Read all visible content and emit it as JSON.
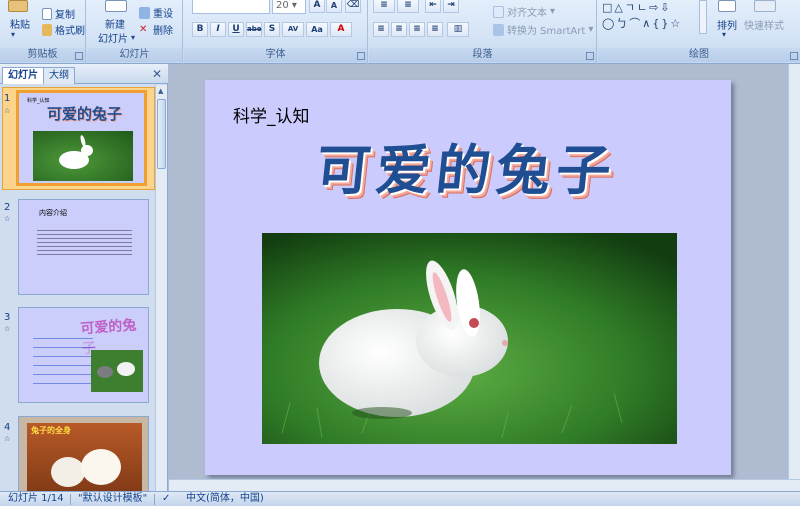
{
  "ribbon": {
    "clipboard": {
      "paste": "粘贴",
      "copy": "复制",
      "format_painter": "格式刷",
      "label": "剪贴板"
    },
    "slides": {
      "new_slide": "新建",
      "new_slide_2": "幻灯片",
      "reset": "重设",
      "delete": "删除",
      "label": "幻灯片"
    },
    "font": {
      "size": "20",
      "label": "字体",
      "bold": "B",
      "italic": "I",
      "underline": "U",
      "strike": "abe",
      "shadow": "S",
      "spacing": "AV",
      "case": "Aa"
    },
    "paragraph": {
      "align_text": "对齐文本",
      "convert_smartart": "转换为 SmartArt",
      "label": "段落"
    },
    "drawing": {
      "arrange": "排列",
      "quick_styles": "快速样式",
      "label": "绘图"
    }
  },
  "left_pane": {
    "tab_slides": "幻灯片",
    "tab_outline": "大纲",
    "close": "✕",
    "thumbnails": [
      {
        "num": "1",
        "sub": "科学_认知",
        "title": "可爱的兔子"
      },
      {
        "num": "2",
        "heading": "内容介绍"
      },
      {
        "num": "3",
        "title": "可爱的兔子"
      },
      {
        "num": "4",
        "title": "兔子的全身"
      }
    ]
  },
  "slide": {
    "subtitle": "科学_认知",
    "title": "可爱的兔子",
    "photo": "white-rabbit-on-grass"
  },
  "status": {
    "slide_counter": "幻灯片 1/14",
    "theme": "\"默认设计模板\"",
    "language": "中文(简体，中国)"
  },
  "colors": {
    "slide_bg": "#cccbfd",
    "title": "#1f4e92",
    "ribbon": "#d5e4f6"
  }
}
